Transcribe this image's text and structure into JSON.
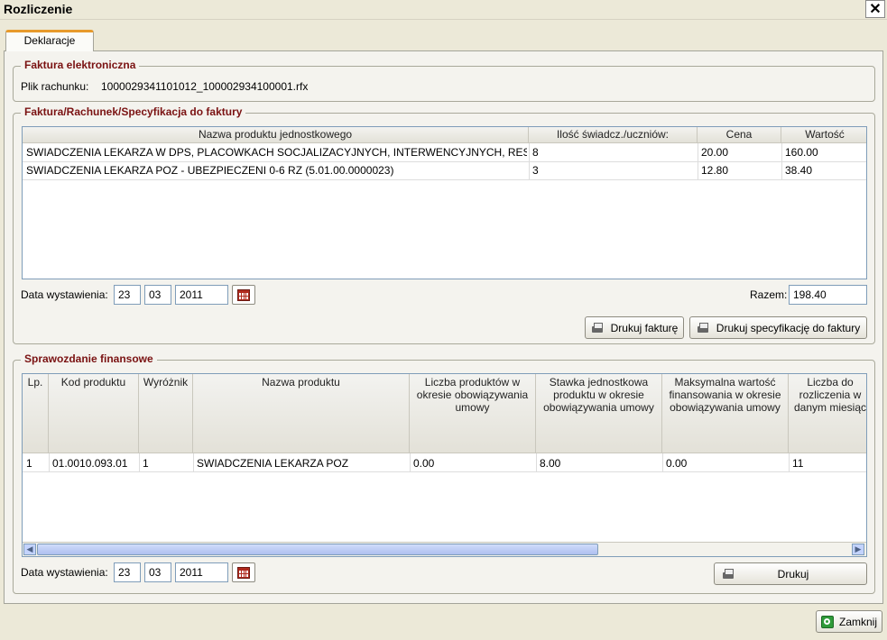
{
  "window": {
    "title": "Rozliczenie"
  },
  "tabs": [
    {
      "label": "Deklaracje"
    }
  ],
  "faktura_elektroniczna": {
    "legend": "Faktura elektroniczna",
    "plik_label": "Plik rachunku:",
    "plik_value": "1000029341101012_100002934100001.rfx"
  },
  "faktura": {
    "legend": "Faktura/Rachunek/Specyfikacja do faktury",
    "columns": [
      "Nazwa produktu jednostkowego",
      "Ilość świadcz./uczniów:",
      "Cena",
      "Wartość"
    ],
    "rows": [
      [
        "SWIADCZENIA LEKARZA W DPS, PLACOWKACH SOCJALIZACYJNYCH, INTERWENCYJNYCH, RESO...",
        "8",
        "20.00",
        "160.00"
      ],
      [
        "SWIADCZENIA LEKARZA POZ - UBEZPIECZENI 0-6 RZ (5.01.00.0000023)",
        "3",
        "12.80",
        "38.40"
      ]
    ],
    "data_label": "Data wystawienia:",
    "dzien": "23",
    "miesiac": "03",
    "rok": "2011",
    "razem_label": "Razem:",
    "razem_value": "198.40",
    "btn_drukuj_fakture": "Drukuj fakturę",
    "btn_drukuj_specyfikacje": "Drukuj specyfikację do faktury"
  },
  "sprawozdanie": {
    "legend": "Sprawozdanie finansowe",
    "columns": [
      "Lp.",
      "Kod produktu",
      "Wyróżnik",
      "Nazwa produktu",
      "Liczba produktów w okresie obowiązywania umowy",
      "Stawka jednostkowa produktu w okresie obowiązywania umowy",
      "Maksymalna wartość finansowania w okresie obowiązywania umowy",
      "Liczba do rozliczenia w danym miesiąc"
    ],
    "rows": [
      [
        "1",
        "01.0010.093.01",
        "1",
        "SWIADCZENIA LEKARZA  POZ",
        "0.00",
        "8.00",
        "0.00",
        "11"
      ]
    ],
    "data_label": "Data wystawienia:",
    "dzien": "23",
    "miesiac": "03",
    "rok": "2011",
    "btn_drukuj": "Drukuj"
  },
  "footer": {
    "btn_zamknij": "Zamknij"
  },
  "icons": {
    "close": "close-icon",
    "printer": "printer-icon",
    "calendar": "calendar-icon",
    "ok": "ok-icon"
  }
}
